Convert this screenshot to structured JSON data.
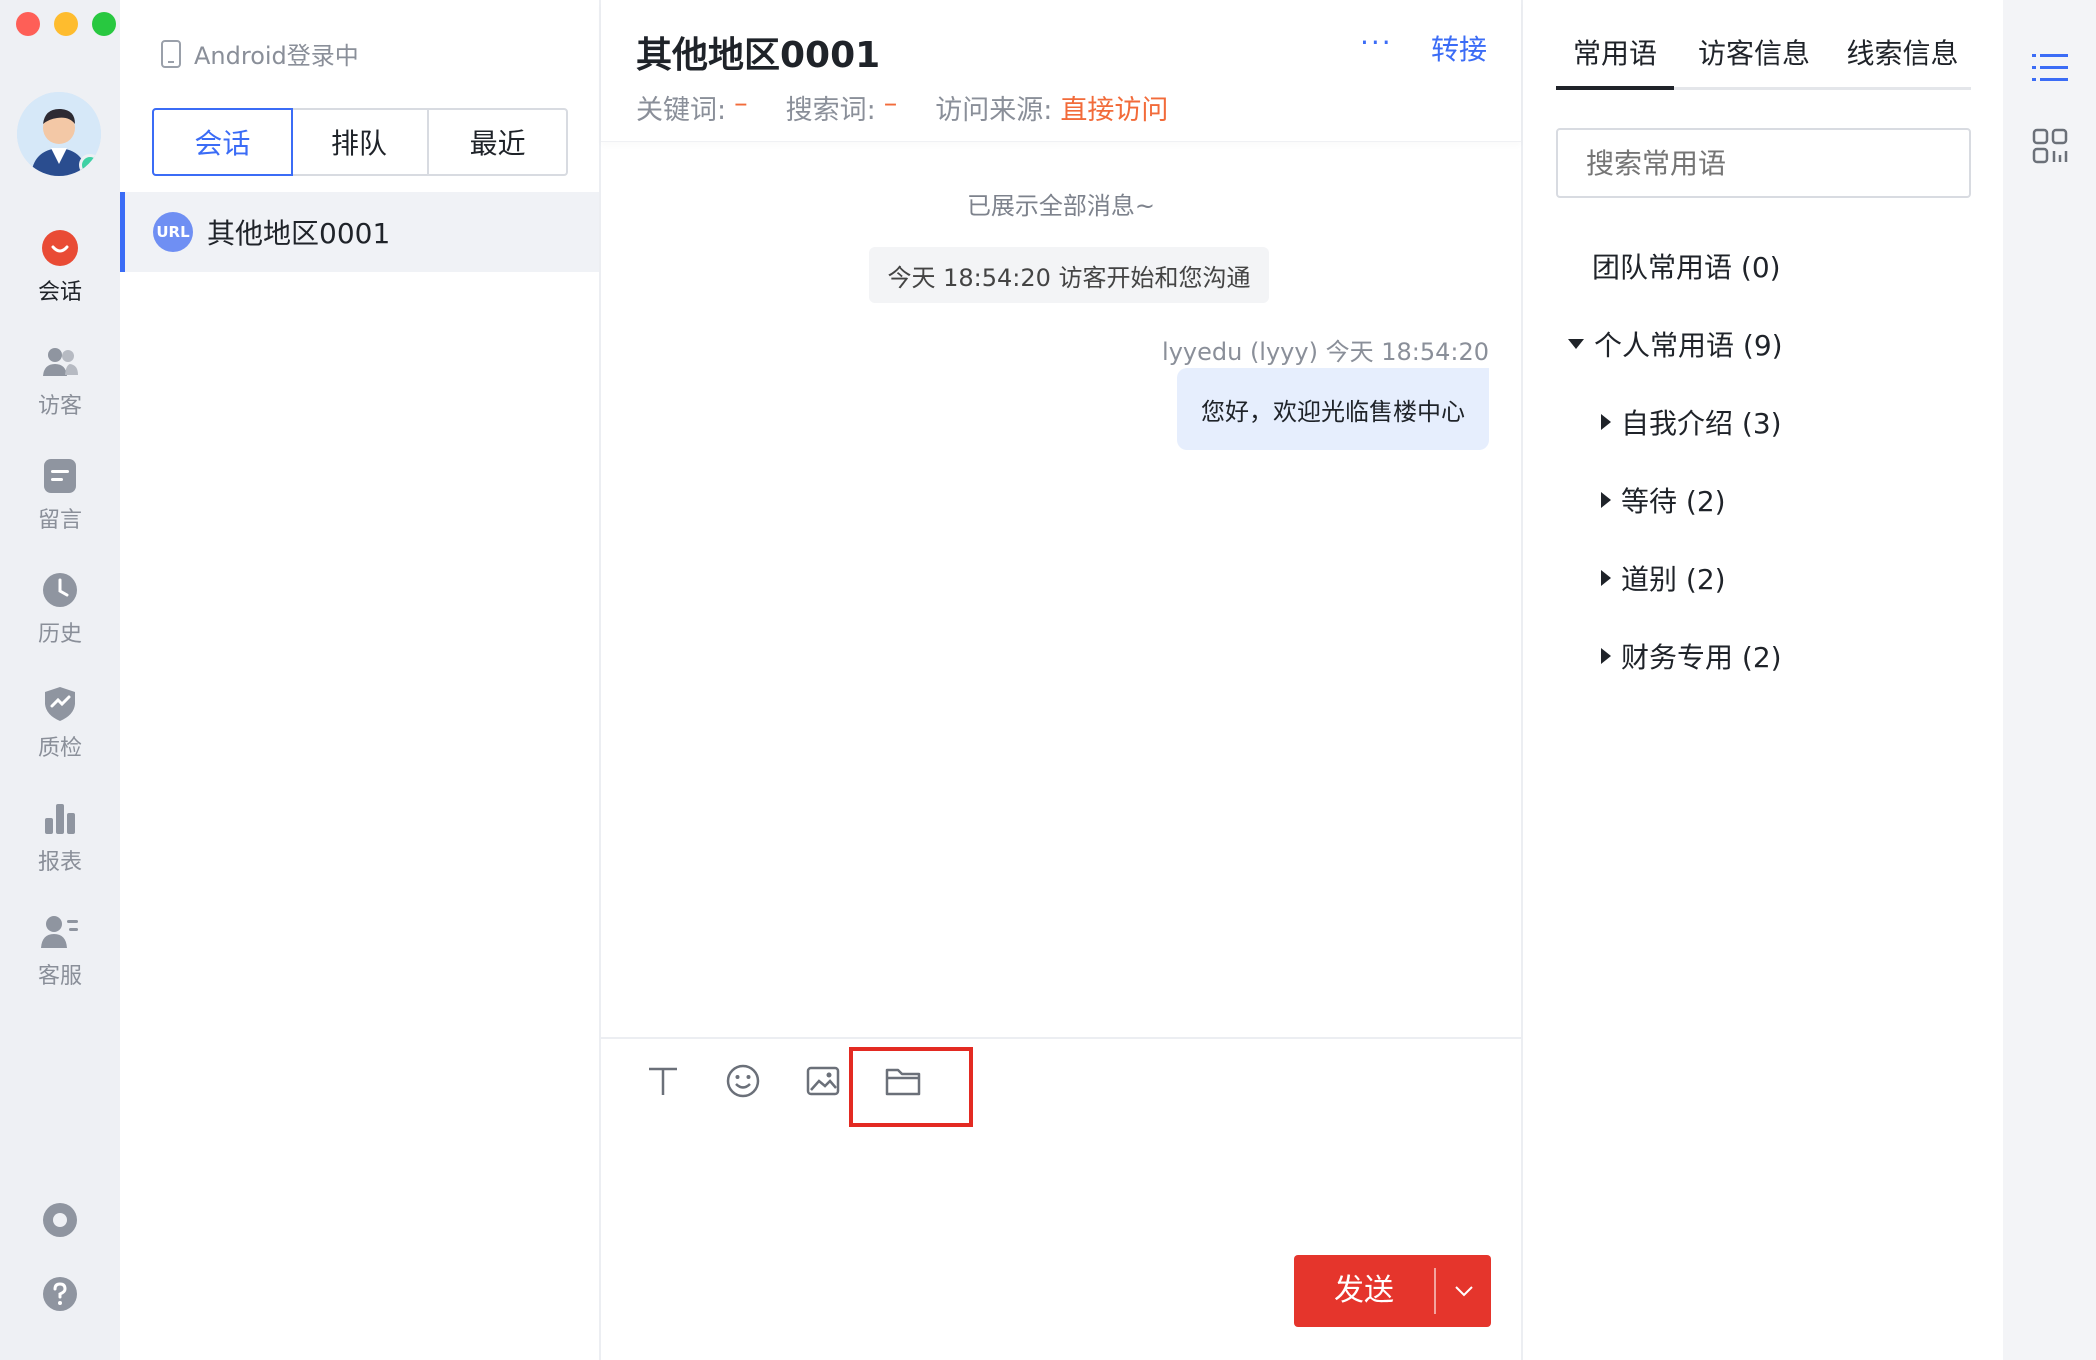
{
  "rail": {
    "items": [
      {
        "label": "会话",
        "icon": "chat-bubble-icon"
      },
      {
        "label": "访客",
        "icon": "visitors-icon"
      },
      {
        "label": "留言",
        "icon": "message-note-icon"
      },
      {
        "label": "历史",
        "icon": "clock-icon"
      },
      {
        "label": "质检",
        "icon": "shield-check-icon"
      },
      {
        "label": "报表",
        "icon": "bar-chart-icon"
      },
      {
        "label": "客服",
        "icon": "agent-icon"
      }
    ],
    "active_color": "#e94b35"
  },
  "list": {
    "status": "Android登录中",
    "tabs": [
      "会话",
      "排队",
      "最近"
    ],
    "sessions": [
      {
        "badge": "URL",
        "name": "其他地区0001"
      }
    ]
  },
  "chat": {
    "title": "其他地区0001",
    "more": "···",
    "transfer": "转接",
    "meta": [
      {
        "label": "关键词:",
        "value": "–"
      },
      {
        "label": "搜索词:",
        "value": "–"
      },
      {
        "label": "访问来源:",
        "value": "直接访问"
      }
    ],
    "system_all": "已展示全部消息~",
    "system_start": "今天 18:54:20 访客开始和您沟通",
    "message": {
      "meta": "lyyedu (lyyy) 今天 18:54:20",
      "text": "您好，欢迎光临售楼中心"
    },
    "send_label": "发送"
  },
  "panel": {
    "tabs": [
      "常用语",
      "访客信息",
      "线索信息"
    ],
    "search_placeholder": "搜索常用语",
    "team": "团队常用语 (0)",
    "personal": "个人常用语 (9)",
    "children": [
      "自我介绍 (3)",
      "等待 (2)",
      "道别 (2)",
      "财务专用 (2)"
    ]
  },
  "colors": {
    "accent": "#3b6cf6",
    "send": "#e5352c",
    "source": "#f26b3a",
    "highlight": "#e32a22"
  }
}
